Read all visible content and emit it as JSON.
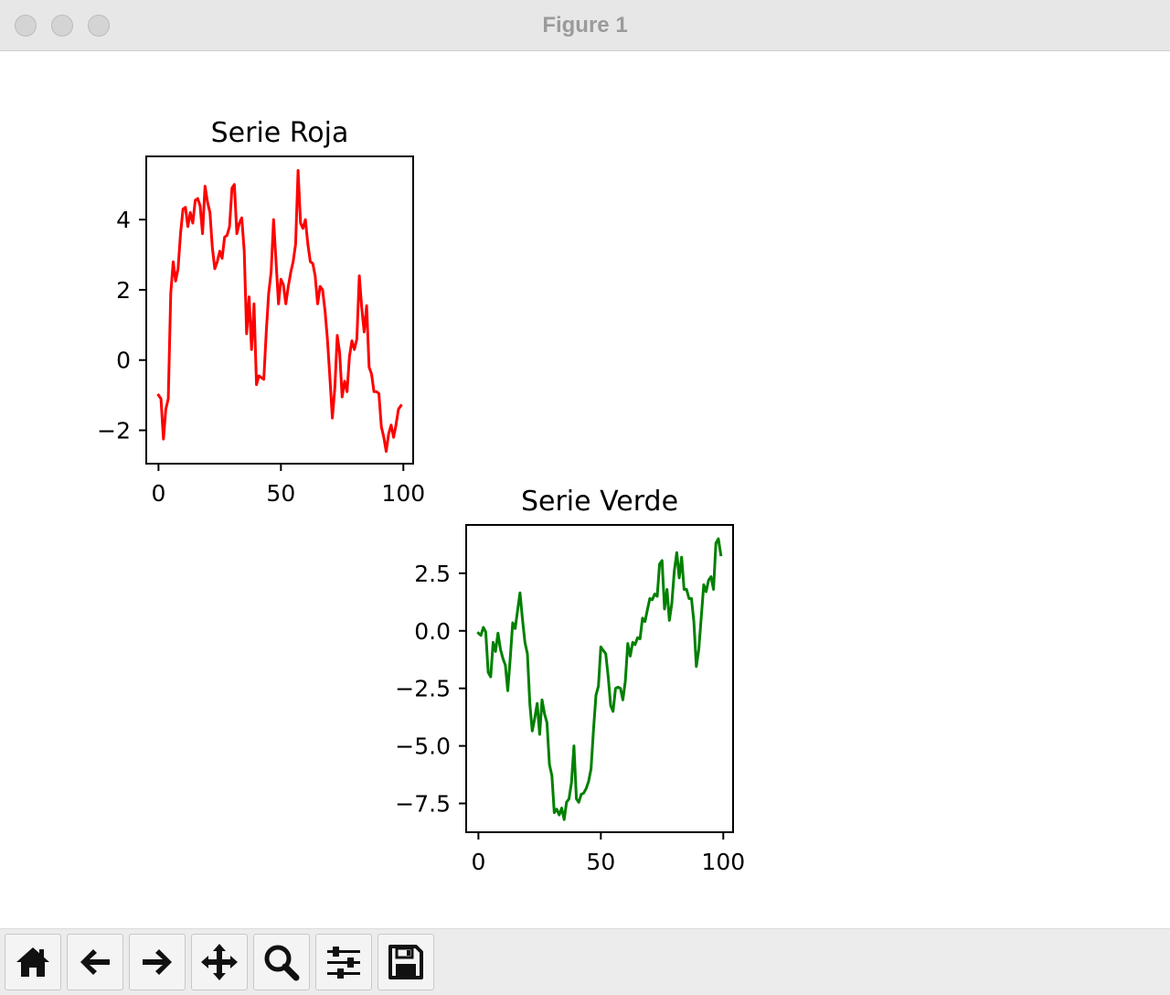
{
  "window": {
    "title": "Figure 1"
  },
  "toolbar": {
    "buttons": [
      {
        "name": "home-button",
        "icon": "home-icon"
      },
      {
        "name": "back-button",
        "icon": "arrow-left-icon"
      },
      {
        "name": "forward-button",
        "icon": "arrow-right-icon"
      },
      {
        "name": "pan-button",
        "icon": "move-icon"
      },
      {
        "name": "zoom-button",
        "icon": "magnifier-icon"
      },
      {
        "name": "configure-subplots-button",
        "icon": "sliders-icon"
      },
      {
        "name": "save-button",
        "icon": "floppy-disk-icon"
      }
    ]
  },
  "chart_data": [
    {
      "type": "line",
      "title": "Serie Roja",
      "color": "#ff0000",
      "xlabel": "",
      "ylabel": "",
      "xlim": [
        -5,
        104
      ],
      "ylim": [
        -2.95,
        5.8
      ],
      "xticks": [
        0,
        50,
        100
      ],
      "yticks": [
        -2,
        0,
        2,
        4
      ],
      "ytick_labels": [
        "−2",
        "0",
        "2",
        "4"
      ],
      "grid": false,
      "x": [
        0,
        1,
        2,
        3,
        4,
        5,
        6,
        7,
        8,
        9,
        10,
        11,
        12,
        13,
        14,
        15,
        16,
        17,
        18,
        19,
        20,
        21,
        22,
        23,
        24,
        25,
        26,
        27,
        28,
        29,
        30,
        31,
        32,
        33,
        34,
        35,
        36,
        37,
        38,
        39,
        40,
        41,
        42,
        43,
        44,
        45,
        46,
        47,
        48,
        49,
        50,
        51,
        52,
        53,
        54,
        55,
        56,
        57,
        58,
        59,
        60,
        61,
        62,
        63,
        64,
        65,
        66,
        67,
        68,
        69,
        70,
        71,
        72,
        73,
        74,
        75,
        76,
        77,
        78,
        79,
        80,
        81,
        82,
        83,
        84,
        85,
        86,
        87,
        88,
        89,
        90,
        91,
        92,
        93,
        94,
        95,
        96,
        97,
        98,
        99
      ],
      "y": [
        -1.0,
        -1.1,
        -2.25,
        -1.4,
        -1.1,
        1.9,
        2.8,
        2.25,
        2.6,
        3.6,
        4.3,
        4.35,
        3.8,
        4.2,
        3.9,
        4.55,
        4.6,
        4.4,
        3.6,
        4.95,
        4.5,
        4.2,
        3.2,
        2.6,
        2.8,
        3.1,
        2.9,
        3.5,
        3.55,
        3.8,
        4.9,
        5.0,
        3.6,
        3.9,
        4.05,
        3.1,
        0.75,
        1.8,
        0.3,
        1.6,
        -0.7,
        -0.45,
        -0.5,
        -0.55,
        0.8,
        1.9,
        2.5,
        4.0,
        2.8,
        1.6,
        2.3,
        2.15,
        1.6,
        2.1,
        2.5,
        2.8,
        3.3,
        5.4,
        3.9,
        3.75,
        4.0,
        3.3,
        2.8,
        2.75,
        2.4,
        1.6,
        2.1,
        2.0,
        1.4,
        0.6,
        -0.5,
        -1.65,
        -0.8,
        0.7,
        0.2,
        -1.05,
        -0.6,
        -0.9,
        0.1,
        0.55,
        0.3,
        0.6,
        2.4,
        1.5,
        0.8,
        1.55,
        -0.2,
        -0.4,
        -0.9,
        -0.9,
        -0.95,
        -1.9,
        -2.2,
        -2.6,
        -2.1,
        -1.85,
        -2.2,
        -1.85,
        -1.4,
        -1.3
      ]
    },
    {
      "type": "line",
      "title": "Serie Verde",
      "color": "#008000",
      "xlabel": "",
      "ylabel": "",
      "xlim": [
        -5,
        104
      ],
      "ylim": [
        -8.75,
        4.6
      ],
      "xticks": [
        0,
        50,
        100
      ],
      "yticks": [
        -7.5,
        -5.0,
        -2.5,
        0.0,
        2.5
      ],
      "ytick_labels": [
        "−7.5",
        "−5.0",
        "−2.5",
        "0.0",
        "2.5"
      ],
      "grid": false,
      "x": [
        0,
        1,
        2,
        3,
        4,
        5,
        6,
        7,
        8,
        9,
        10,
        11,
        12,
        13,
        14,
        15,
        16,
        17,
        18,
        19,
        20,
        21,
        22,
        23,
        24,
        25,
        26,
        27,
        28,
        29,
        30,
        31,
        32,
        33,
        34,
        35,
        36,
        37,
        38,
        39,
        40,
        41,
        42,
        43,
        44,
        45,
        46,
        47,
        48,
        49,
        50,
        51,
        52,
        53,
        54,
        55,
        56,
        57,
        58,
        59,
        60,
        61,
        62,
        63,
        64,
        65,
        66,
        67,
        68,
        69,
        70,
        71,
        72,
        73,
        74,
        75,
        76,
        77,
        78,
        79,
        80,
        81,
        82,
        83,
        84,
        85,
        86,
        87,
        88,
        89,
        90,
        91,
        92,
        93,
        94,
        95,
        96,
        97,
        98,
        99
      ],
      "y": [
        -0.1,
        -0.2,
        0.15,
        -0.05,
        -1.8,
        -2.0,
        -0.5,
        -0.9,
        -0.1,
        -0.8,
        -1.2,
        -1.5,
        -2.6,
        -1.2,
        0.35,
        0.1,
        0.9,
        1.65,
        0.5,
        -0.5,
        -1.0,
        -3.2,
        -4.35,
        -3.8,
        -3.15,
        -4.5,
        -3.0,
        -3.6,
        -4.0,
        -5.8,
        -6.3,
        -7.9,
        -7.75,
        -8.0,
        -7.7,
        -8.2,
        -7.45,
        -7.3,
        -6.6,
        -5.0,
        -7.3,
        -7.45,
        -7.1,
        -7.05,
        -6.85,
        -6.55,
        -6.0,
        -4.3,
        -2.8,
        -2.4,
        -0.7,
        -0.85,
        -1.0,
        -2.0,
        -3.25,
        -3.5,
        -2.5,
        -2.45,
        -2.5,
        -3.0,
        -2.2,
        -0.55,
        -1.1,
        -0.5,
        -0.6,
        -0.3,
        -0.35,
        0.55,
        0.4,
        0.9,
        1.4,
        1.35,
        1.6,
        1.5,
        2.9,
        3.05,
        0.95,
        1.8,
        0.45,
        1.2,
        2.6,
        3.4,
        2.3,
        3.2,
        1.8,
        1.8,
        1.4,
        1.4,
        0.4,
        -1.55,
        -0.8,
        0.6,
        2.0,
        1.7,
        2.2,
        2.35,
        1.8,
        3.8,
        4.0,
        3.3
      ]
    }
  ]
}
